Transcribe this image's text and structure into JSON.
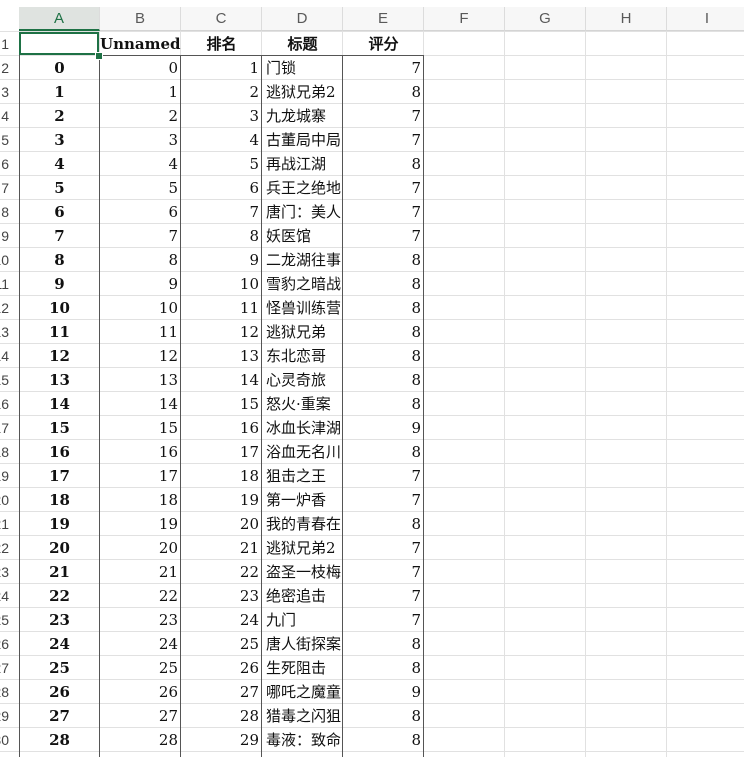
{
  "columns": [
    "A",
    "B",
    "C",
    "D",
    "E",
    "F",
    "G",
    "H",
    "I"
  ],
  "selected_column": "A",
  "header_row": {
    "row_number": "1",
    "cells": [
      "",
      "Unnamed:",
      "排名",
      "标题",
      "评分"
    ]
  },
  "rows": [
    {
      "n": "2",
      "a": "0",
      "b": "0",
      "c": "1",
      "d": "门锁",
      "e": "7"
    },
    {
      "n": "3",
      "a": "1",
      "b": "1",
      "c": "2",
      "d": "逃狱兄弟2",
      "e": "8"
    },
    {
      "n": "4",
      "a": "2",
      "b": "2",
      "c": "3",
      "d": "九龙城寨",
      "e": "7"
    },
    {
      "n": "5",
      "a": "3",
      "b": "3",
      "c": "4",
      "d": "古董局中局",
      "e": "7"
    },
    {
      "n": "6",
      "a": "4",
      "b": "4",
      "c": "5",
      "d": "再战江湖",
      "e": "8"
    },
    {
      "n": "7",
      "a": "5",
      "b": "5",
      "c": "6",
      "d": "兵王之绝地",
      "e": "7"
    },
    {
      "n": "8",
      "a": "6",
      "b": "6",
      "c": "7",
      "d": "唐门：美人",
      "e": "7"
    },
    {
      "n": "9",
      "a": "7",
      "b": "7",
      "c": "8",
      "d": "妖医馆",
      "e": "7"
    },
    {
      "n": "10",
      "a": "8",
      "b": "8",
      "c": "9",
      "d": "二龙湖往事",
      "e": "8"
    },
    {
      "n": "11",
      "a": "9",
      "b": "9",
      "c": "10",
      "d": "雪豹之暗战",
      "e": "8"
    },
    {
      "n": "12",
      "a": "10",
      "b": "10",
      "c": "11",
      "d": "怪兽训练营",
      "e": "8"
    },
    {
      "n": "13",
      "a": "11",
      "b": "11",
      "c": "12",
      "d": "逃狱兄弟",
      "e": "8"
    },
    {
      "n": "14",
      "a": "12",
      "b": "12",
      "c": "13",
      "d": "东北恋哥",
      "e": "8"
    },
    {
      "n": "15",
      "a": "13",
      "b": "13",
      "c": "14",
      "d": "心灵奇旅",
      "e": "8"
    },
    {
      "n": "16",
      "a": "14",
      "b": "14",
      "c": "15",
      "d": "怒火·重案",
      "e": "8"
    },
    {
      "n": "17",
      "a": "15",
      "b": "15",
      "c": "16",
      "d": "冰血长津湖",
      "e": "9"
    },
    {
      "n": "18",
      "a": "16",
      "b": "16",
      "c": "17",
      "d": "浴血无名川",
      "e": "8"
    },
    {
      "n": "19",
      "a": "17",
      "b": "17",
      "c": "18",
      "d": "狙击之王",
      "e": "7"
    },
    {
      "n": "20",
      "a": "18",
      "b": "18",
      "c": "19",
      "d": "第一炉香",
      "e": "7"
    },
    {
      "n": "21",
      "a": "19",
      "b": "19",
      "c": "20",
      "d": "我的青春在",
      "e": "8"
    },
    {
      "n": "22",
      "a": "20",
      "b": "20",
      "c": "21",
      "d": "逃狱兄弟2",
      "e": "7"
    },
    {
      "n": "23",
      "a": "21",
      "b": "21",
      "c": "22",
      "d": "盗圣一枝梅",
      "e": "7"
    },
    {
      "n": "24",
      "a": "22",
      "b": "22",
      "c": "23",
      "d": "绝密追击",
      "e": "7"
    },
    {
      "n": "25",
      "a": "23",
      "b": "23",
      "c": "24",
      "d": "九门",
      "e": "7"
    },
    {
      "n": "26",
      "a": "24",
      "b": "24",
      "c": "25",
      "d": "唐人街探案",
      "e": "8"
    },
    {
      "n": "27",
      "a": "25",
      "b": "25",
      "c": "26",
      "d": "生死阻击",
      "e": "8"
    },
    {
      "n": "28",
      "a": "26",
      "b": "26",
      "c": "27",
      "d": "哪吒之魔童",
      "e": "9"
    },
    {
      "n": "29",
      "a": "27",
      "b": "27",
      "c": "28",
      "d": "猎毒之闪狙",
      "e": "8"
    },
    {
      "n": "30",
      "a": "28",
      "b": "28",
      "c": "29",
      "d": "毒液：致命",
      "e": "8"
    }
  ]
}
